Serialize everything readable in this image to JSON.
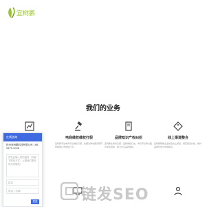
{
  "brand": {
    "logo_text": "宜树鹏"
  },
  "section": {
    "title": "我们的业务"
  },
  "services": [
    {
      "icon": "chart-icon",
      "name": "",
      "desc": ""
    },
    {
      "icon": "gavel-icon",
      "name": "电商维权维权打假",
      "desc": "宜树鹏专注电商平台维权打假，依据法律依据采取有效措施打击侵权行为。"
    },
    {
      "icon": "document-icon",
      "name": "品牌知识产权纠纷",
      "desc": "宜树鹏在商标注册、品牌维权打击、商标异议等方面有丰富经验，助力企业品牌保护。"
    },
    {
      "icon": "tag-icon",
      "name": "线上渠道整合",
      "desc": "宜树鹏帮助企业整合线上渠道，规范渠道价格，维护品牌形象与市场秩序。"
    }
  ],
  "chat": {
    "header": "在线咨询",
    "greeting": "杭州宜树鹏科技有限公司 186-5675-5098",
    "message_placeholder": "请在此输入您的留言（可留下联系方式，以便我们更好地为您服务）",
    "name_placeholder": "姓名",
    "phone_placeholder": "电话（必填）",
    "send_label": "发送"
  },
  "watermark": {
    "text": "链发",
    "suffix": "SEO"
  }
}
